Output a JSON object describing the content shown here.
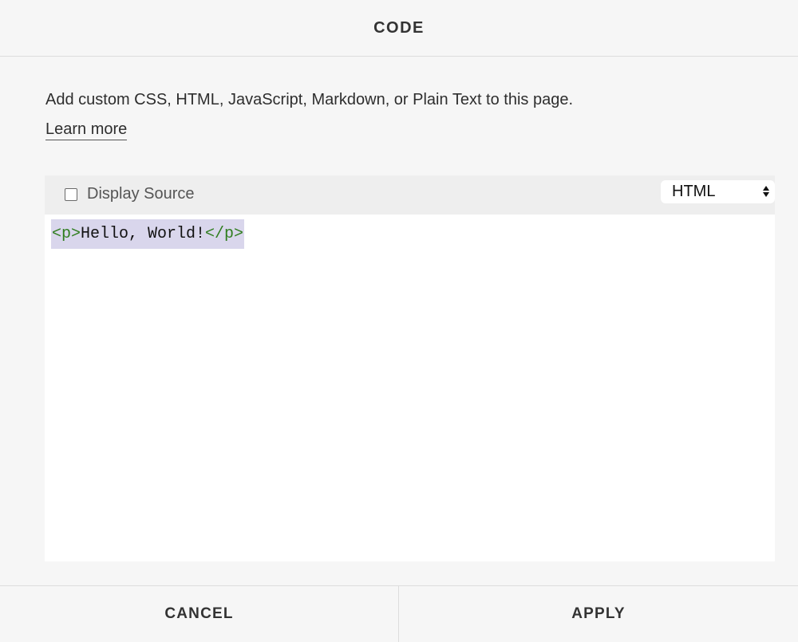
{
  "header": {
    "title": "CODE"
  },
  "description": "Add custom CSS, HTML, JavaScript, Markdown, or Plain Text to this page.",
  "learn_more_label": "Learn more",
  "toolbar": {
    "display_source_label": "Display Source",
    "display_source_checked": false,
    "language_selected": "HTML"
  },
  "code": {
    "open_tag": "<p>",
    "content": "Hello, World!",
    "close_tag": "</p>"
  },
  "footer": {
    "cancel_label": "CANCEL",
    "apply_label": "APPLY"
  }
}
